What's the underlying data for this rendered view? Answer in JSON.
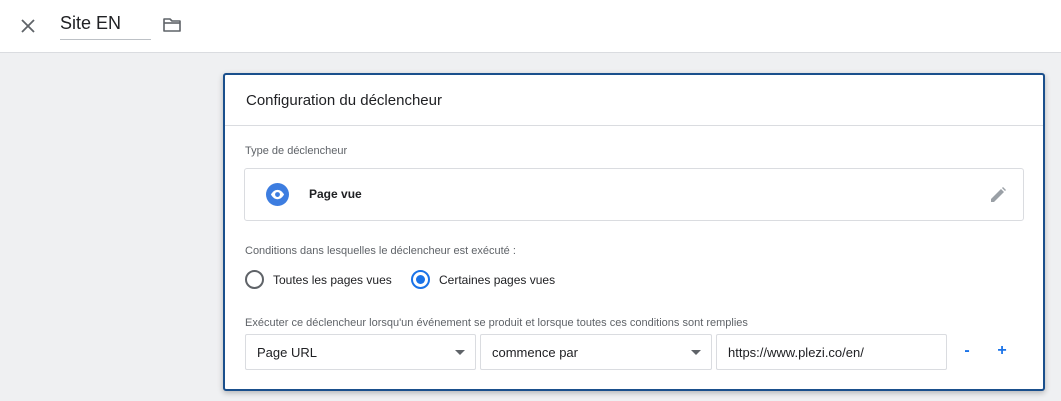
{
  "header": {
    "close_icon": "close-icon",
    "title_value": "Site EN",
    "folder_icon": "folder-icon"
  },
  "card": {
    "title": "Configuration du déclencheur",
    "trigger_type_label": "Type de déclencheur",
    "trigger_type": {
      "icon": "eye-icon",
      "name": "Page vue",
      "edit_icon": "pencil-icon"
    },
    "conditions_label": "Conditions dans lesquelles le déclencheur est exécuté :",
    "radio_options": [
      {
        "label": "Toutes les pages vues",
        "checked": false
      },
      {
        "label": "Certaines pages vues",
        "checked": true
      }
    ],
    "filter_label": "Exécuter ce déclencheur lorsqu'un événement se produit et lorsque toutes ces conditions sont remplies",
    "filter": {
      "variable": "Page URL",
      "operator": "commence par",
      "value": "https://www.plezi.co/en/",
      "remove_label": "-",
      "add_label": "+"
    }
  },
  "colors": {
    "accent": "#1a73e8",
    "card_border": "#1a4f8c",
    "eye_badge": "#3d7de0",
    "background": "#eff0f2"
  }
}
